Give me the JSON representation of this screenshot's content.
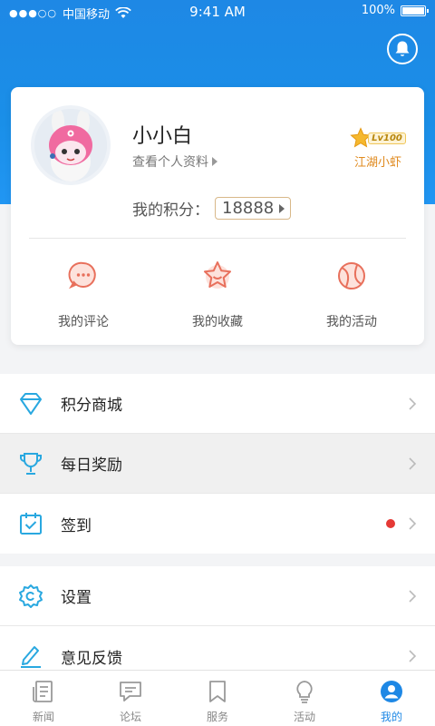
{
  "status_bar": {
    "signal": "●●●○○",
    "carrier": "中国移动",
    "time": "9:41 AM",
    "battery": "100%"
  },
  "profile": {
    "username": "小小白",
    "view_profile": "查看个人资料",
    "level": "Lv100",
    "level_title": "江湖小虾",
    "points_label": "我的积分：",
    "points_value": "18888"
  },
  "quick_actions": [
    {
      "label": "我的评论",
      "icon": "comment-icon"
    },
    {
      "label": "我的收藏",
      "icon": "star-icon"
    },
    {
      "label": "我的活动",
      "icon": "ball-icon"
    }
  ],
  "menu_group1": [
    {
      "label": "积分商城",
      "icon": "diamond-icon"
    },
    {
      "label": "每日奖励",
      "icon": "trophy-icon"
    },
    {
      "label": "签到",
      "icon": "calendar-check-icon",
      "badge": "red-dot"
    }
  ],
  "menu_group2": [
    {
      "label": "设置",
      "icon": "gear-icon"
    },
    {
      "label": "意见反馈",
      "icon": "edit-icon"
    }
  ],
  "tabs": [
    {
      "label": "新闻",
      "icon": "news-icon"
    },
    {
      "label": "论坛",
      "icon": "forum-icon"
    },
    {
      "label": "服务",
      "icon": "bookmark-icon"
    },
    {
      "label": "活动",
      "icon": "bulb-icon"
    },
    {
      "label": "我的",
      "icon": "user-icon",
      "active": true
    }
  ],
  "colors": {
    "primary": "#1e88e5",
    "accent_red": "#e8705c",
    "icon_blue": "#29a8e0",
    "gold": "#e08a1e"
  }
}
